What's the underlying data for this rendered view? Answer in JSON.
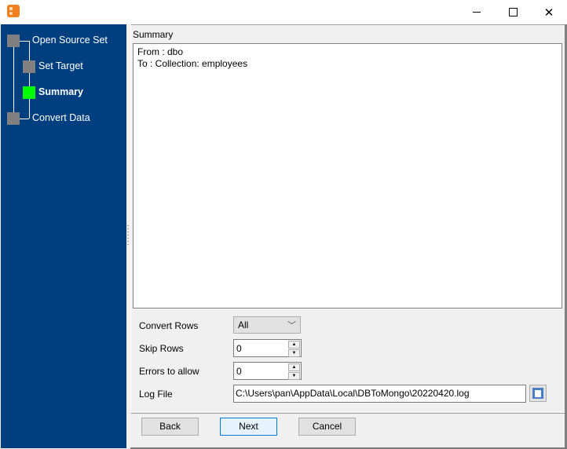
{
  "window": {
    "icon": "app-icon",
    "controls": {
      "minimize": "minimize-icon",
      "maximize": "maximize-icon",
      "close": "close-icon"
    }
  },
  "colors": {
    "sidebar_bg": "#003f7f",
    "active_step": "#00ff00",
    "inactive_step": "#808080",
    "default_button_border": "#0078d7"
  },
  "steps": [
    {
      "label": "Open Source Set",
      "state": "done"
    },
    {
      "label": "Set Target",
      "state": "done"
    },
    {
      "label": "Summary",
      "state": "active"
    },
    {
      "label": "Convert Data",
      "state": "pending"
    }
  ],
  "summary": {
    "title": "Summary",
    "lines": [
      "From : dbo",
      "To : Collection: employees"
    ]
  },
  "form": {
    "convert_rows": {
      "label": "Convert Rows",
      "value": "All"
    },
    "skip_rows": {
      "label": "Skip Rows",
      "value": "0"
    },
    "errors_to_allow": {
      "label": "Errors to allow",
      "value": "0"
    },
    "log_file": {
      "label": "Log File",
      "value": "C:\\Users\\pan\\AppData\\Local\\DBToMongo\\20220420.log"
    }
  },
  "buttons": {
    "back": "Back",
    "next": "Next",
    "cancel": "Cancel"
  },
  "glyphs": {
    "x": "✕",
    "chevron": "﹀",
    "up": "▲",
    "down": "▼"
  }
}
